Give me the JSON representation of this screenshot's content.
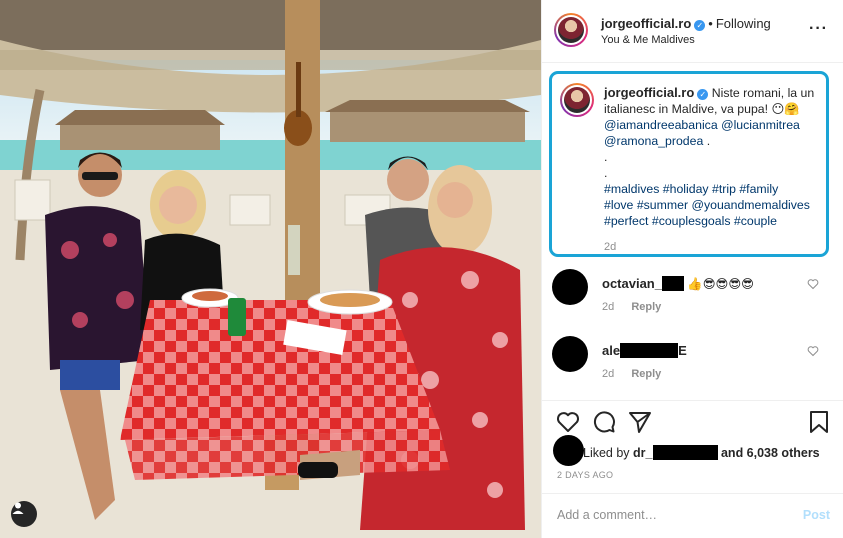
{
  "post": {
    "author": "jorgeofficial.ro",
    "separator": "•",
    "follow_status": "Following",
    "location": "You & Me Maldives",
    "more_icon": "more-horizontal-icon"
  },
  "caption": {
    "author": "jorgeofficial.ro",
    "text": "Niste romani, la un italianesc in Maldive, va pupa! 😶🤗",
    "mentions": [
      "@iamandreeabanica",
      "@lucianmitrea",
      "@ramona_prodea",
      "."
    ],
    "dots": [
      ".",
      "."
    ],
    "hashtags_line1": "#maldives #holiday #trip #family",
    "hashtags_line2": "#love #summer @youandmemaldives",
    "hashtags_line3": "#perfect #couplesgoals #couple",
    "time": "2d"
  },
  "comments": [
    {
      "user": "octavian_",
      "text": "👍😎😎😎😎",
      "time": "2d",
      "reply": "Reply"
    },
    {
      "user_prefix": "ale",
      "user_suffix": "E",
      "time": "2d",
      "reply": "Reply"
    }
  ],
  "actions": {
    "liked_by_prefix": "Liked by",
    "liked_by_user": "dr_",
    "liked_by_suffix": "and 6,038 others",
    "posted_ago": "2 DAYS AGO"
  },
  "comment_box": {
    "placeholder": "Add a comment…",
    "post_label": "Post"
  },
  "colors": {
    "caption_highlight": "#1aa4d6",
    "link": "#00376b",
    "verified": "#3897f0",
    "post_disabled": "#b2dffc"
  }
}
